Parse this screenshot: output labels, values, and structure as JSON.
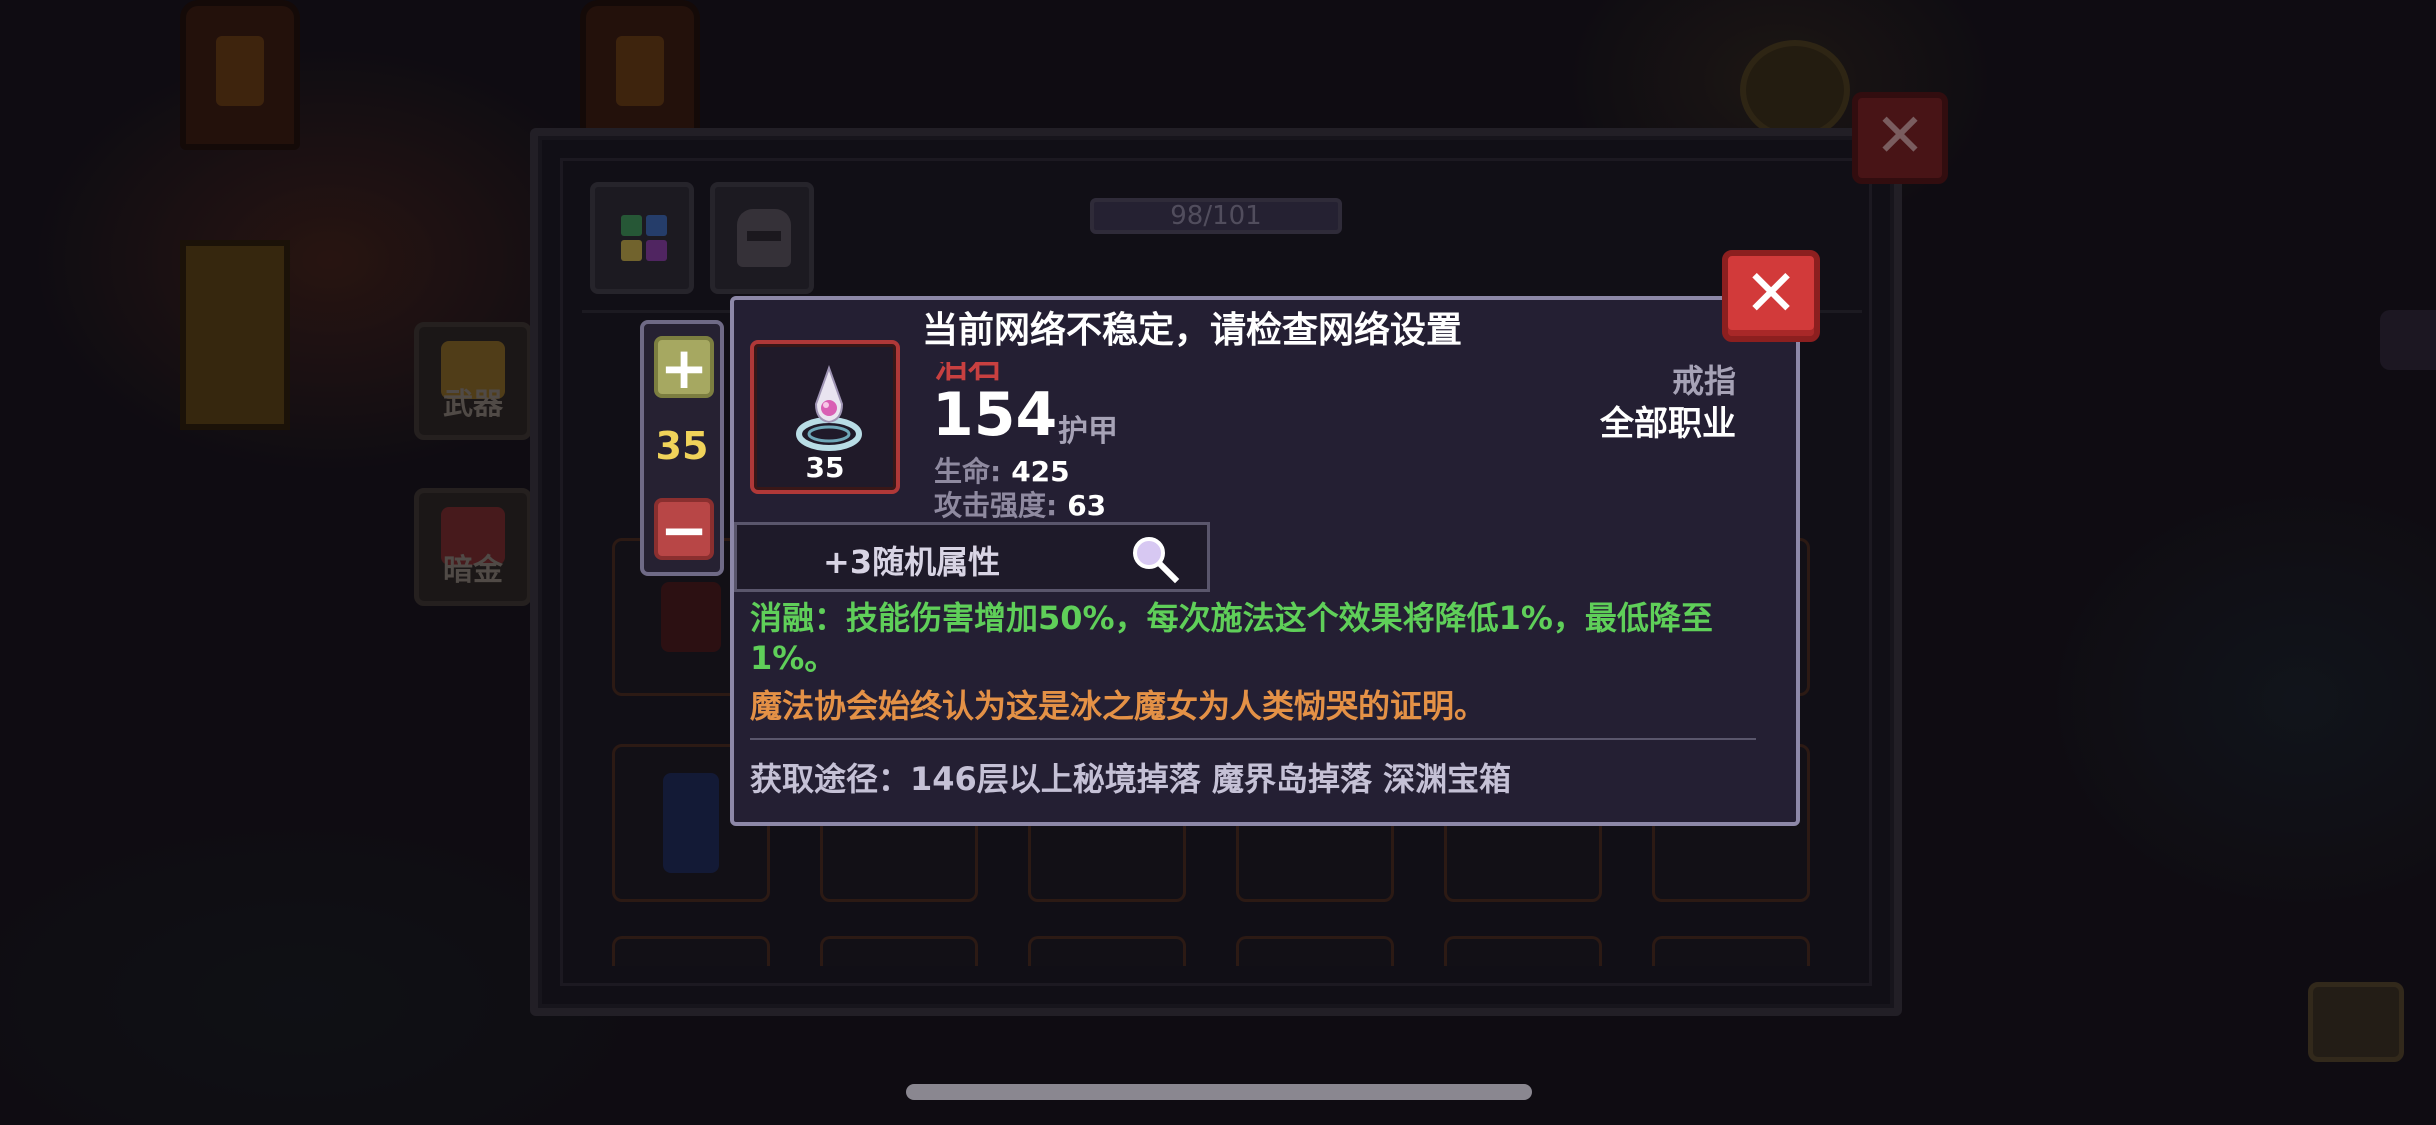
{
  "background": {
    "side_tabs": [
      {
        "label": "武器",
        "color": "#8a6a24"
      },
      {
        "label": "暗金",
        "color": "#7a2a2a"
      }
    ]
  },
  "inventory": {
    "capacity": "98/101"
  },
  "stepper": {
    "plus_label": "+",
    "minus_label": "−",
    "value": "35"
  },
  "toast": {
    "message": "当前网络不稳定，请检查网络设置"
  },
  "item": {
    "name": "泪石",
    "level": "35",
    "armor_value": "154",
    "armor_label": "护甲",
    "stats": [
      {
        "label": "生命:",
        "value": "425"
      },
      {
        "label": "攻击强度:",
        "value": "63"
      }
    ],
    "type": "戒指",
    "class_restriction": "全部职业",
    "random_attributes": "+3随机属性",
    "effect": "消融：技能伤害增加50%，每次施法这个效果将降低1%，最低降至1%。",
    "lore": "魔法协会始终认为这是冰之魔女为人类恸哭的证明。",
    "source": "获取途径：146层以上秘境掉落 魔界岛掉落 深渊宝箱"
  },
  "buttons": {
    "close_label": "✕"
  },
  "colors": {
    "effect_green": "#5fcf59",
    "lore_orange": "#e49146",
    "name_red": "#c84040",
    "level_yellow": "#f0d35a",
    "close_red": "#d23a3a"
  },
  "icons": [
    "ring-icon",
    "magnifier-icon",
    "plus-icon",
    "minus-icon",
    "close-icon",
    "grid-icon",
    "helmet-icon"
  ]
}
